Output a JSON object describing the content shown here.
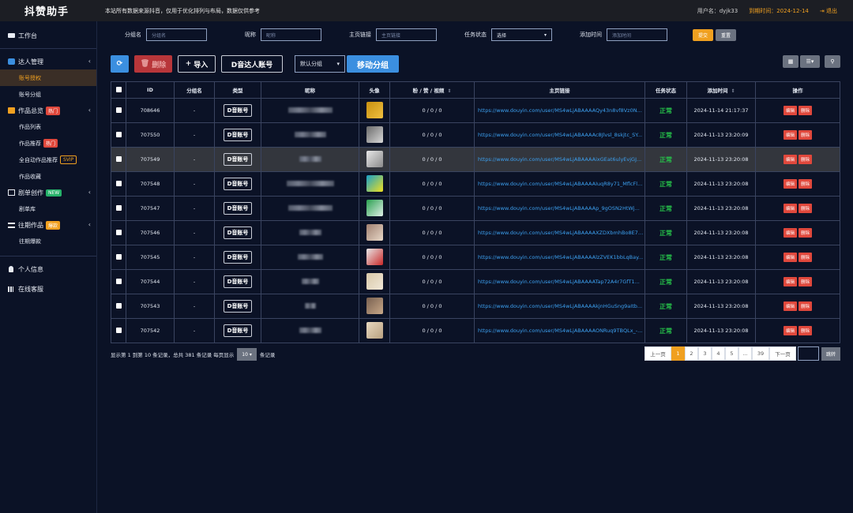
{
  "header": {
    "logo": "抖赞助手",
    "notice": "本站所有数据来源抖音，仅用于优化排列与布局，数据仅供参考",
    "user_label": "用户名：dyjk33",
    "expire_label": "到期时间：2024-12-14",
    "logout": "退出"
  },
  "sidebar": {
    "workbench": "工作台",
    "talent": "达人管理",
    "account_auth": "账号授权",
    "account_group": "账号分组",
    "works_overview": "作品总览",
    "hot": "热门",
    "works_list": "作品列表",
    "works_recommend": "作品推荐",
    "auto_recommend": "全自动作品推荐",
    "svip": "SVIP",
    "works_fav": "作品收藏",
    "script_create": "剧单创作",
    "new": "NEW",
    "script_lib": "剧单库",
    "past_works": "往期作品",
    "boom": "爆款",
    "past_boom": "往期爆款",
    "personal": "个人信息",
    "service": "在线客服"
  },
  "filters": {
    "group_label": "分组名",
    "group_ph": "分组名",
    "nick_label": "昵称",
    "nick_ph": "昵称",
    "link_label": "主页链接",
    "link_ph": "主页链接",
    "status_label": "任务状态",
    "status_value": "选择",
    "time_label": "添加时间",
    "time_ph": "添加时间",
    "submit": "提交",
    "reset": "重置"
  },
  "toolbar": {
    "delete": "删除",
    "import": "导入",
    "dy_account": "D音达人账号",
    "group_select": "默认分组",
    "move_group": "移动分组"
  },
  "table": {
    "headers": [
      "ID",
      "分组名",
      "类型",
      "昵称",
      "头像",
      "粉 / 赞 / 视频",
      "主页链接",
      "任务状态",
      "添加时间",
      "操作"
    ],
    "type_tag": "D音账号",
    "status": "正常",
    "edit": "编辑",
    "del": "删除",
    "rows": [
      {
        "id": "708646",
        "group": "-",
        "stats": "0 / 0 / 0",
        "link": "https://www.douyin.com/user/MS4wLjABAAAAQy43n8vf8Vz0N...",
        "time": "2024-11-14 21:17:37"
      },
      {
        "id": "707550",
        "group": "-",
        "stats": "0 / 0 / 0",
        "link": "https://www.douyin.com/user/MS4wLjABAAAAc8Jlvsl_8skjtc_SY...",
        "time": "2024-11-13 23:20:09"
      },
      {
        "id": "707549",
        "group": "-",
        "stats": "0 / 0 / 0",
        "link": "https://www.douyin.com/user/MS4wLjABAAAAixGEat6ulyEvjGJ...",
        "time": "2024-11-13 23:20:08"
      },
      {
        "id": "707548",
        "group": "-",
        "stats": "0 / 0 / 0",
        "link": "https://www.douyin.com/user/MS4wLjABAAAAIuqR8y71_MflcFl...",
        "time": "2024-11-13 23:20:08"
      },
      {
        "id": "707547",
        "group": "-",
        "stats": "0 / 0 / 0",
        "link": "https://www.douyin.com/user/MS4wLjABAAAAp_9gOSN2HtWj...",
        "time": "2024-11-13 23:20:08"
      },
      {
        "id": "707546",
        "group": "-",
        "stats": "0 / 0 / 0",
        "link": "https://www.douyin.com/user/MS4wLjABAAAAXZDXbmhBo8E7b...",
        "time": "2024-11-13 23:20:08"
      },
      {
        "id": "707545",
        "group": "-",
        "stats": "0 / 0 / 0",
        "link": "https://www.douyin.com/user/MS4wLjABAAAAlzZVEK1bbLqBay...",
        "time": "2024-11-13 23:20:08"
      },
      {
        "id": "707544",
        "group": "-",
        "stats": "0 / 0 / 0",
        "link": "https://www.douyin.com/user/MS4wLjABAAAATap72A4r7GfT1...",
        "time": "2024-11-13 23:20:08"
      },
      {
        "id": "707543",
        "group": "-",
        "stats": "0 / 0 / 0",
        "link": "https://www.douyin.com/user/MS4wLjABAAAAkjnHGuSng9aItb...",
        "time": "2024-11-13 23:20:08"
      },
      {
        "id": "707542",
        "group": "-",
        "stats": "0 / 0 / 0",
        "link": "https://www.douyin.com/user/MS4wLjABAAAAONRuq9TBQLx_-...",
        "time": "2024-11-13 23:20:08"
      }
    ]
  },
  "footer": {
    "info": "显示第 1 到第 10 条记录，总共 381 条记录 每页显示",
    "page_size": "10",
    "suffix": "条记录"
  },
  "pager": {
    "prev": "上一页",
    "pages": [
      "1",
      "2",
      "3",
      "4",
      "5",
      "...",
      "39"
    ],
    "next": "下一页",
    "jump": "跳转"
  },
  "colors": {
    "accent": "#f0a020",
    "danger": "#e0483c",
    "primary": "#3b8fe0",
    "ok": "#26c24a"
  }
}
